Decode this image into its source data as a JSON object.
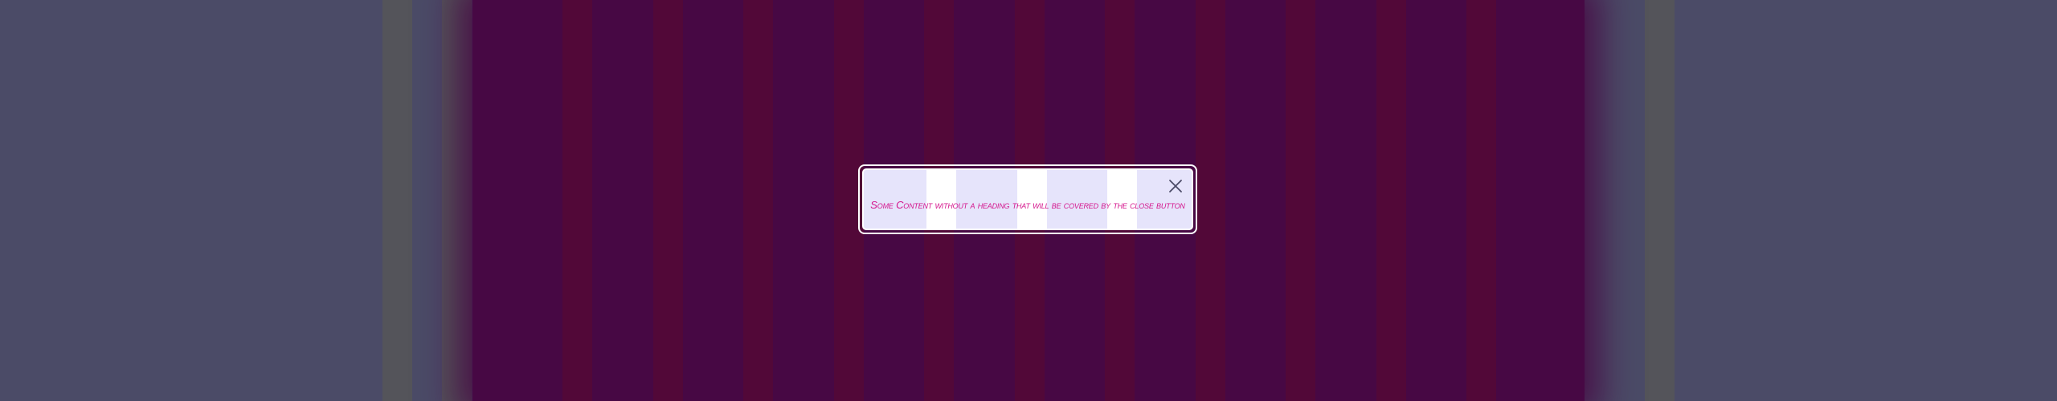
{
  "dialog": {
    "content_text": "Some Content without a heading that will be covered by the close button",
    "close_icon": "close-icon",
    "text_color": "#d4148c",
    "background_color": "#e6e4fb"
  },
  "colors": {
    "page_background": "#4b4b67",
    "backdrop": "#470844",
    "backdrop_stripe": "#520838",
    "outer_stripe": "#54545a"
  }
}
